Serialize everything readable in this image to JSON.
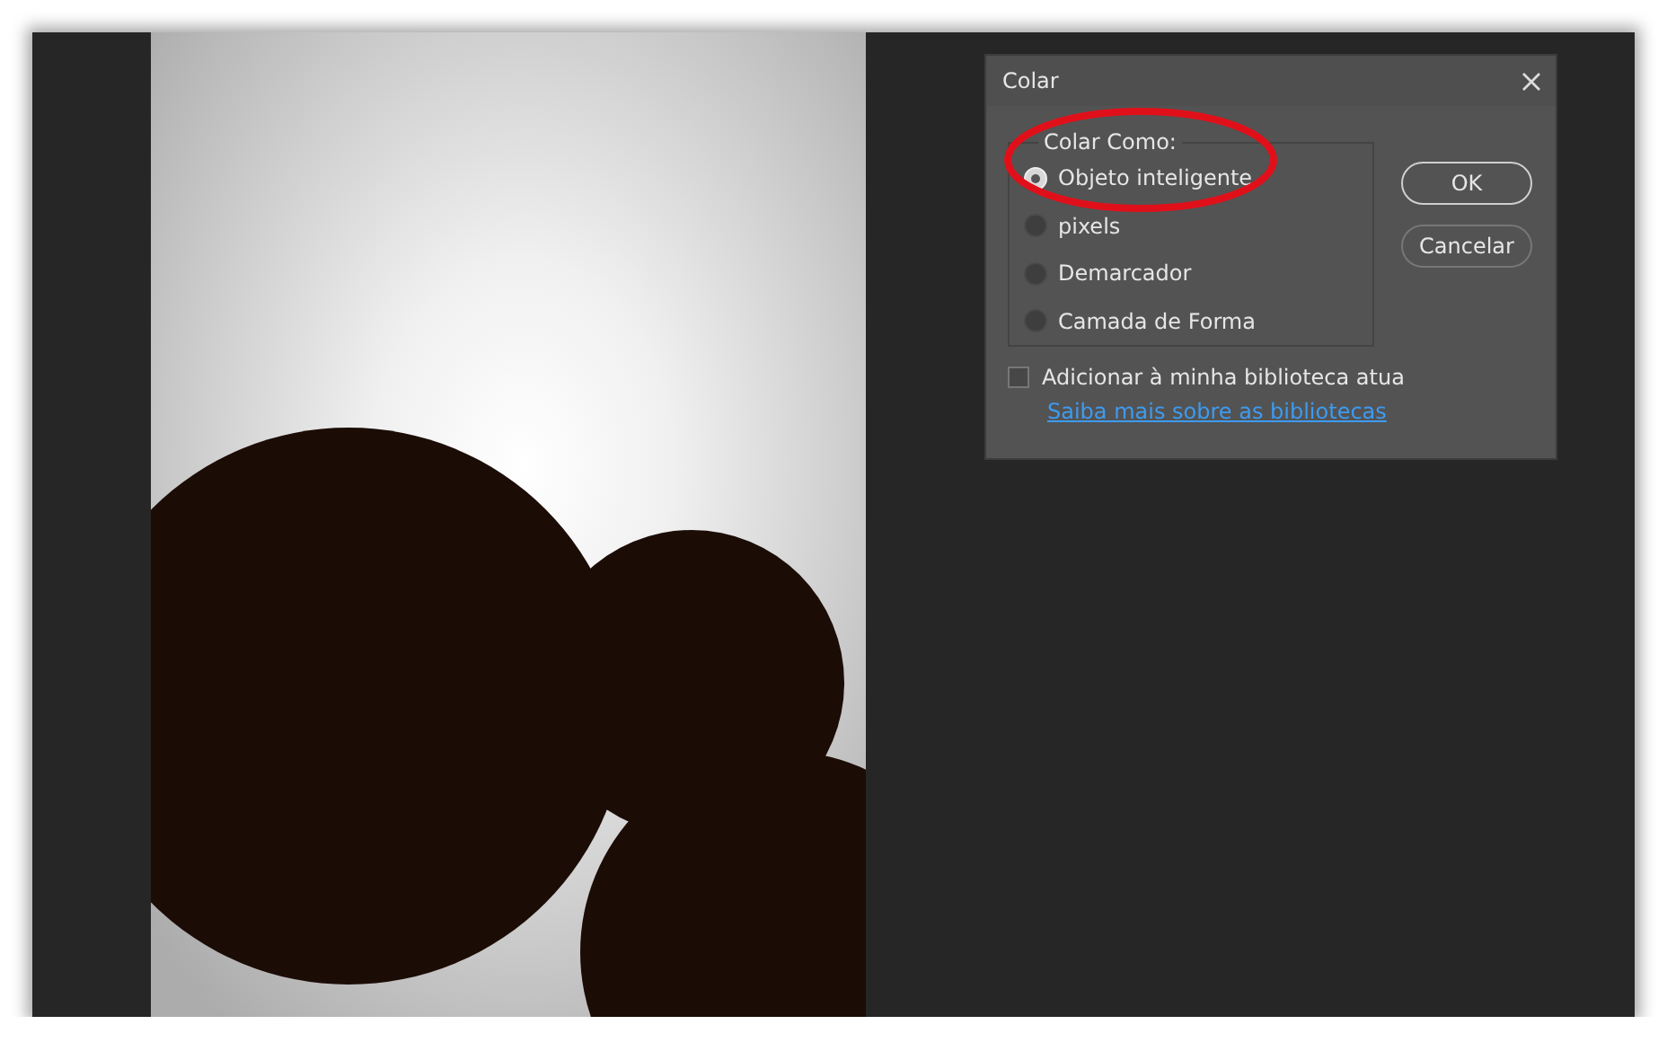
{
  "dialog": {
    "title": "Colar",
    "group": {
      "legend": "Colar Como:",
      "options": [
        {
          "label": "Objeto inteligente",
          "selected": true
        },
        {
          "label": "pixels",
          "selected": false
        },
        {
          "label": "Demarcador",
          "selected": false
        },
        {
          "label": "Camada de Forma",
          "selected": false
        }
      ]
    },
    "checkbox": {
      "label": "Adicionar à minha biblioteca atua",
      "checked": false
    },
    "link": "Saiba mais sobre as bibliotecas",
    "buttons": [
      {
        "label": "OK",
        "default": true
      },
      {
        "label": "Cancelar",
        "default": false
      }
    ]
  }
}
